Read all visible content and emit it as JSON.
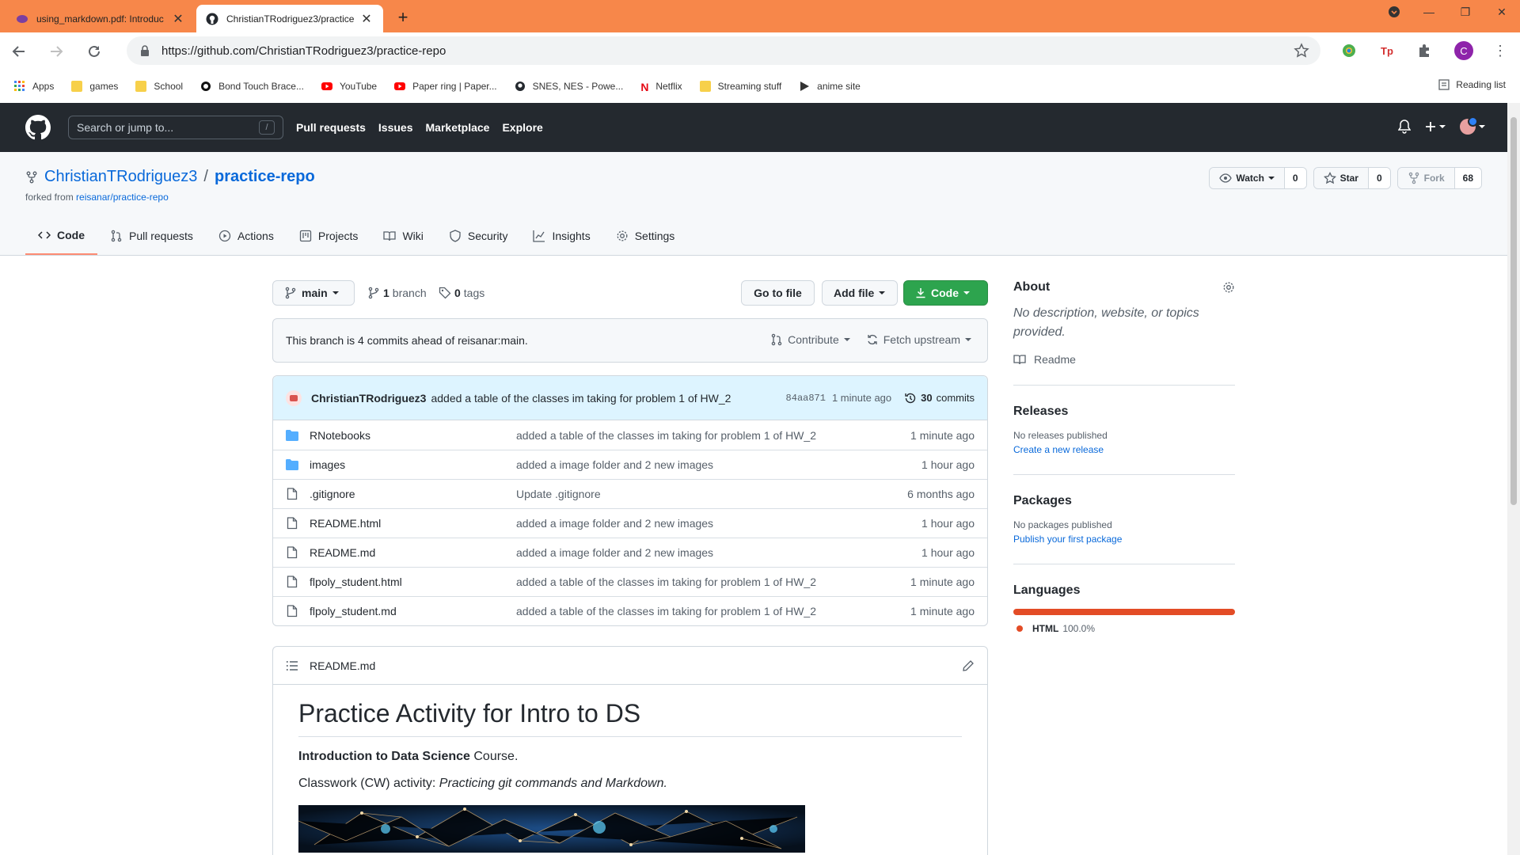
{
  "browser": {
    "tabs": [
      {
        "title": "using_markdown.pdf: Introduc"
      },
      {
        "title": "ChristianTRodriguez3/practice"
      }
    ],
    "url": "https://github.com/ChristianTRodriguez3/practice-repo",
    "profile_initial": "C",
    "bookmarks": [
      "Apps",
      "games",
      "School",
      "Bond Touch Brace...",
      "YouTube",
      "Paper ring | Paper...",
      "SNES, NES - Powe...",
      "Netflix",
      "Streaming stuff",
      "anime site"
    ],
    "reading_list": "Reading list",
    "colors": {
      "tabstrip": "#f7874a"
    }
  },
  "gh": {
    "search_placeholder": "Search or jump to...",
    "search_key": "/",
    "nav": [
      "Pull requests",
      "Issues",
      "Marketplace",
      "Explore"
    ]
  },
  "repo": {
    "owner": "ChristianTRodriguez3",
    "sep": "/",
    "name": "practice-repo",
    "forked_prefix": "forked from",
    "forked_from": "reisanar/practice-repo",
    "watch": {
      "label": "Watch",
      "count": "0"
    },
    "star": {
      "label": "Star",
      "count": "0"
    },
    "fork": {
      "label": "Fork",
      "count": "68"
    },
    "tabs": [
      "Code",
      "Pull requests",
      "Actions",
      "Projects",
      "Wiki",
      "Security",
      "Insights",
      "Settings"
    ]
  },
  "filebar": {
    "branch": "main",
    "branches_n": "1",
    "branches_label": "branch",
    "tags_n": "0",
    "tags_label": "tags",
    "goto": "Go to file",
    "add": "Add file",
    "code": "Code"
  },
  "ahead": {
    "text": "This branch is 4 commits ahead of reisanar:main.",
    "contribute": "Contribute",
    "fetch": "Fetch upstream"
  },
  "commit": {
    "author": "ChristianTRodriguez3",
    "message": "added a table of the classes im taking for problem 1 of HW_2",
    "sha": "84aa871",
    "time": "1 minute ago",
    "count_n": "30",
    "count_label": "commits"
  },
  "files": [
    {
      "type": "dir",
      "name": "RNotebooks",
      "msg": "added a table of the classes im taking for problem 1 of HW_2",
      "age": "1 minute ago"
    },
    {
      "type": "dir",
      "name": "images",
      "msg": "added a image folder and 2 new images",
      "age": "1 hour ago"
    },
    {
      "type": "file",
      "name": ".gitignore",
      "msg": "Update .gitignore",
      "age": "6 months ago"
    },
    {
      "type": "file",
      "name": "README.html",
      "msg": "added a image folder and 2 new images",
      "age": "1 hour ago"
    },
    {
      "type": "file",
      "name": "README.md",
      "msg": "added a image folder and 2 new images",
      "age": "1 hour ago"
    },
    {
      "type": "file",
      "name": "flpoly_student.html",
      "msg": "added a table of the classes im taking for problem 1 of HW_2",
      "age": "1 minute ago"
    },
    {
      "type": "file",
      "name": "flpoly_student.md",
      "msg": "added a table of the classes im taking for problem 1 of HW_2",
      "age": "1 minute ago"
    }
  ],
  "readme": {
    "filename": "README.md",
    "h1": "Practice Activity for Intro to DS",
    "p1_bold": "Introduction to Data Science",
    "p1_rest": " Course.",
    "p2_prefix": "Classwork (CW) activity: ",
    "p2_em": "Practicing git commands and Markdown."
  },
  "sidebar": {
    "about": "About",
    "desc": "No description, website, or topics provided.",
    "readme": "Readme",
    "releases": "Releases",
    "releases_none": "No releases published",
    "releases_link": "Create a new release",
    "packages": "Packages",
    "packages_none": "No packages published",
    "packages_link": "Publish your first package",
    "languages": "Languages",
    "lang_name": "HTML",
    "lang_pct": "100.0%",
    "lang_color": "#e34c26"
  }
}
